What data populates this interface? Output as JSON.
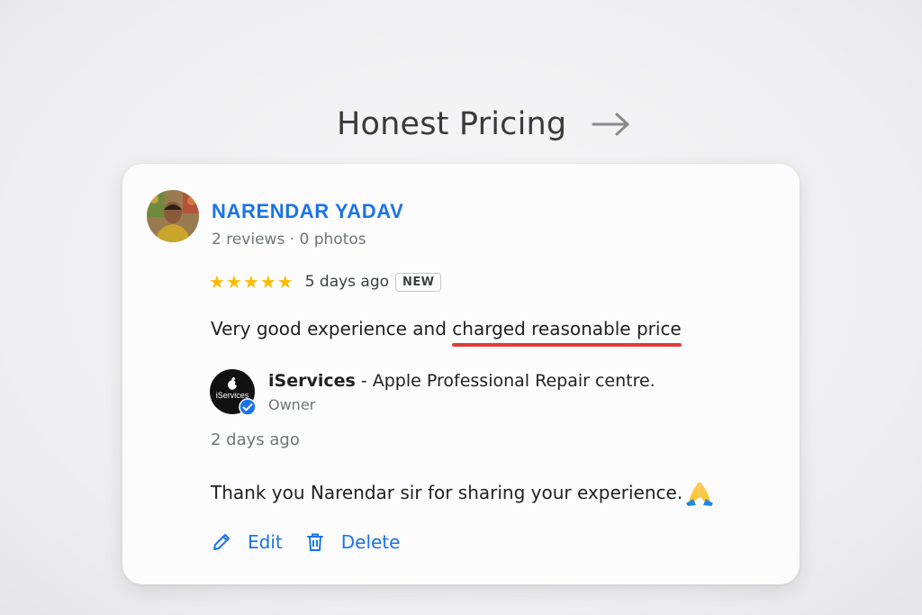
{
  "header": {
    "title": "Honest Pricing",
    "arrow_icon": "arrow-right-icon"
  },
  "review": {
    "reviewer_name": "NARENDAR YADAV",
    "reviewer_meta": "2 reviews · 0 photos",
    "rating": 5,
    "stars": [
      "★",
      "★",
      "★",
      "★",
      "★"
    ],
    "date": "5 days ago",
    "badge": "NEW",
    "text_plain": "Very good experience and ",
    "text_highlight": "charged reasonable price"
  },
  "owner_reply": {
    "logo_text": "iServices",
    "business_name": "iServices",
    "business_suffix": " - Apple Professional Repair centre.",
    "role": "Owner",
    "date": "2 days ago",
    "text": "Thank you Narendar sir for sharing your experience.",
    "emoji_icon": "folded-hands-icon"
  },
  "actions": {
    "edit_label": "Edit",
    "delete_label": "Delete"
  },
  "colors": {
    "link_blue": "#1a73e8",
    "star_yellow": "#fbbc04",
    "underline_red": "#e53935",
    "verified_blue": "#1a73e8"
  }
}
